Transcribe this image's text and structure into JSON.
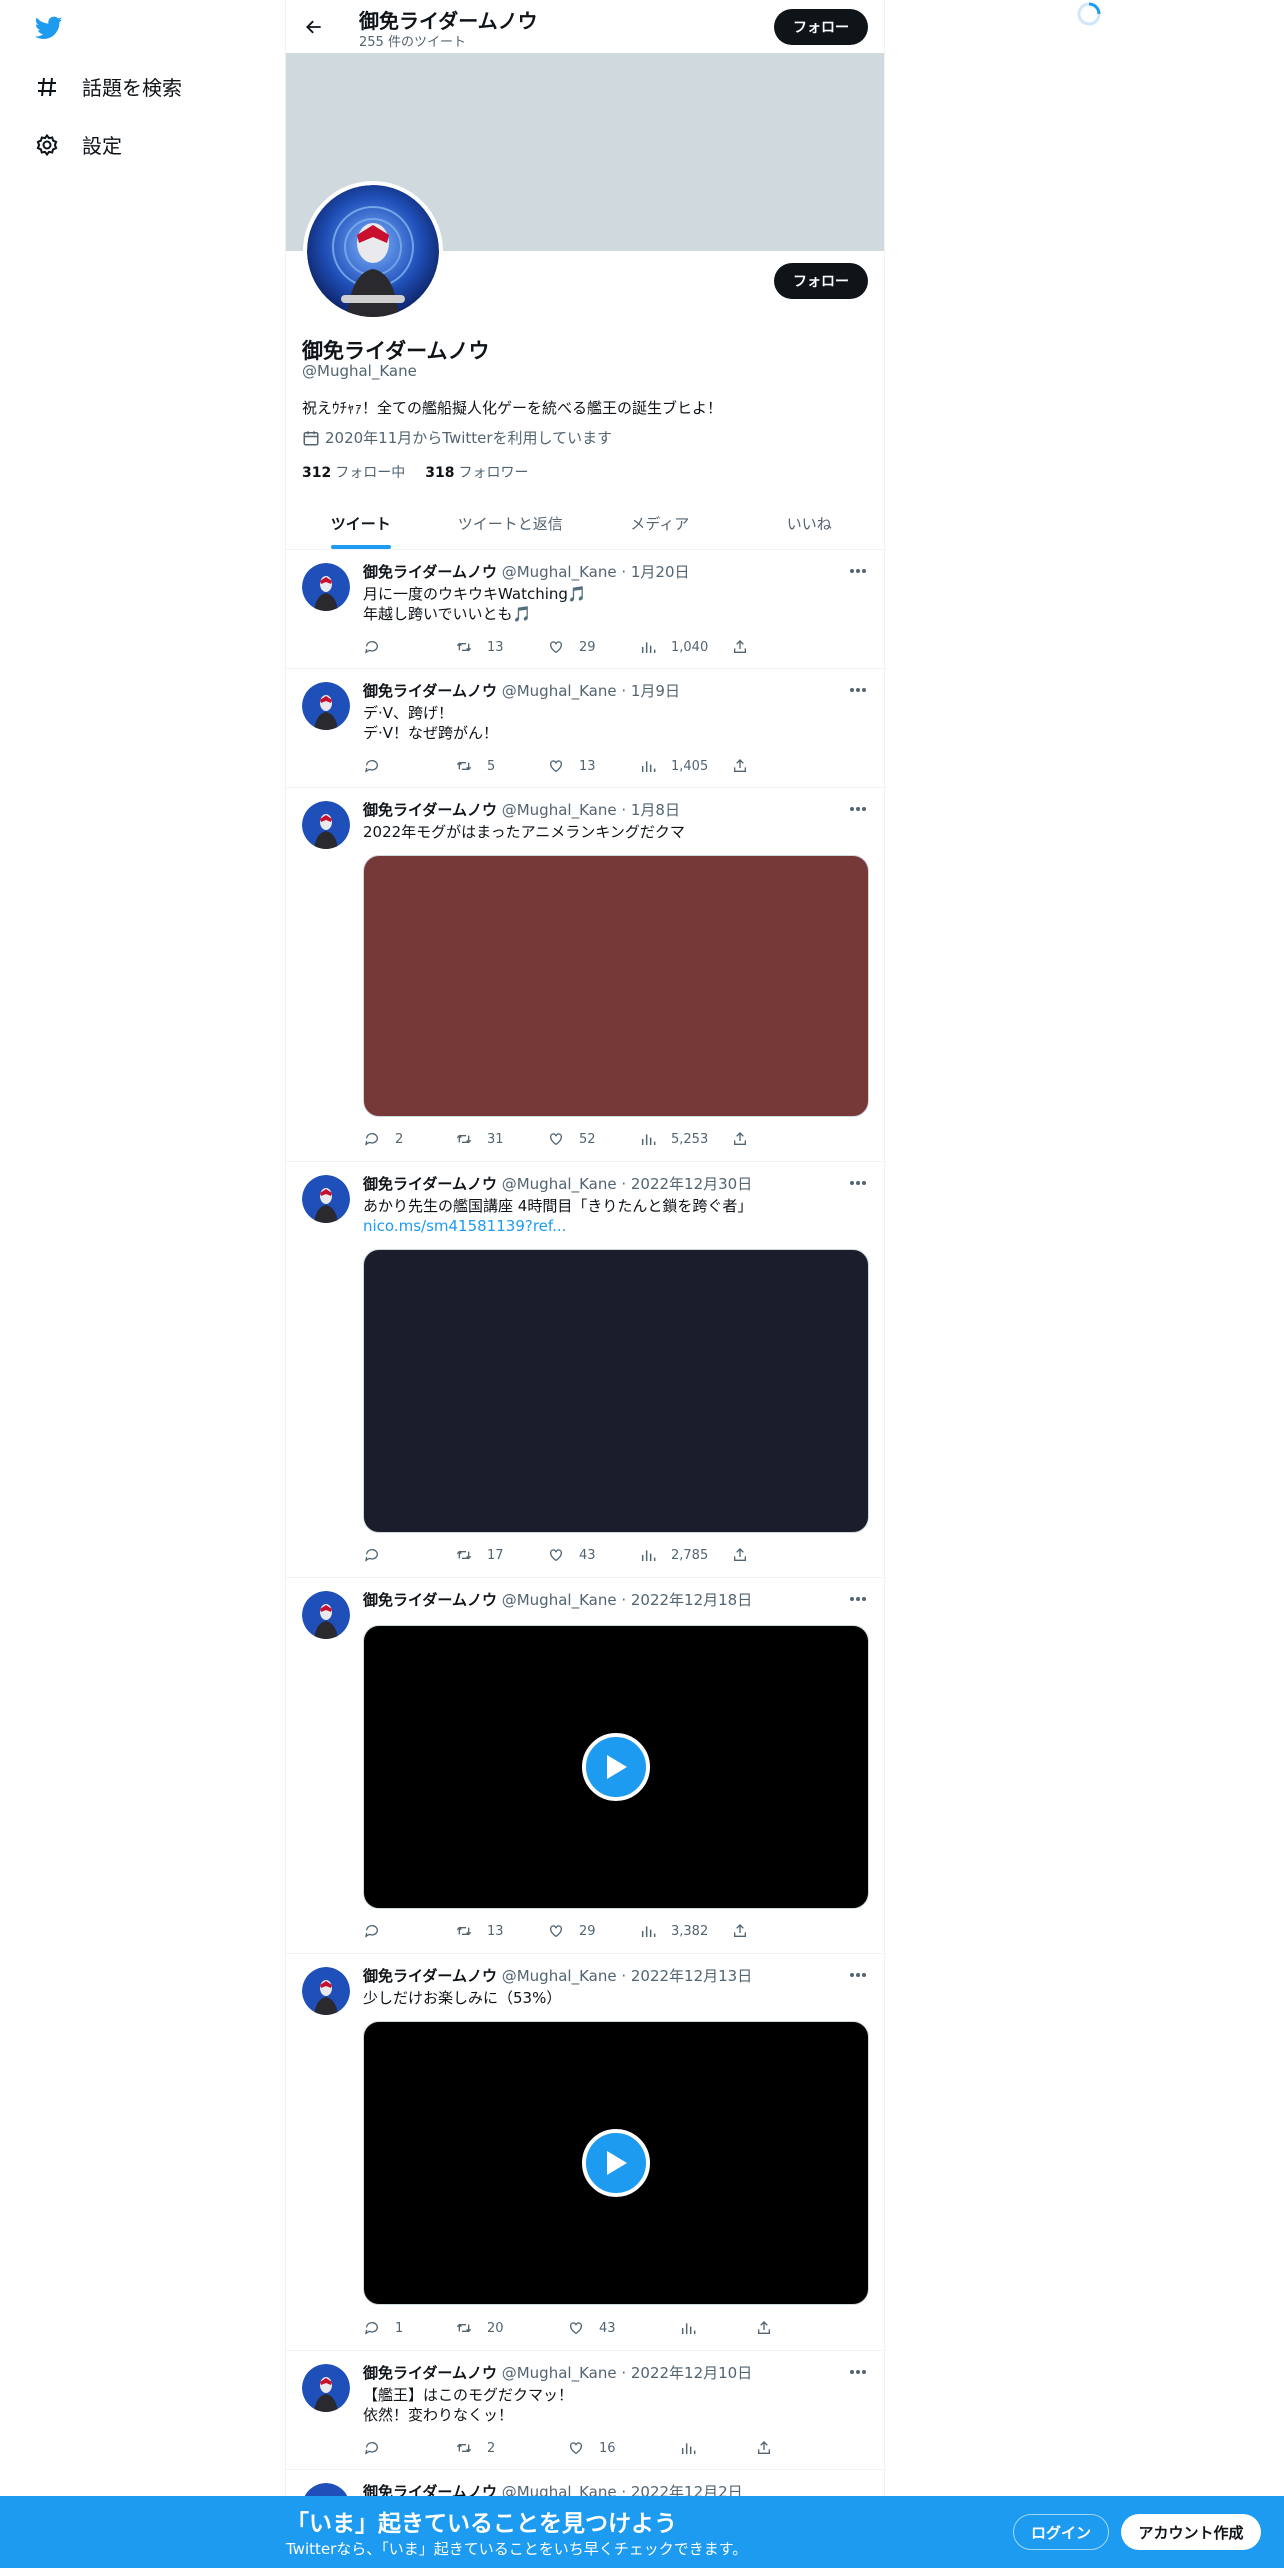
{
  "nav": {
    "items": [
      {
        "icon": "hashtag-icon",
        "label": "話題を検索"
      },
      {
        "icon": "gear-icon",
        "label": "設定"
      }
    ]
  },
  "header": {
    "name": "御免ライダームノウ",
    "tweet_count": "255 件のツイート",
    "follow_label": "フォロー"
  },
  "profile": {
    "name": "御免ライダームノウ",
    "handle": "@Mughal_Kane",
    "bio": "祝えｳﾁｬｧ！全ての艦船擬人化ゲーを統べる艦王の誕生ブヒよ！",
    "joined": "2020年11月からTwitterを利用しています",
    "following_count": "312",
    "following_label": "フォロー中",
    "followers_count": "318",
    "followers_label": "フォロワー",
    "follow_label": "フォロー"
  },
  "tabs": [
    "ツイート",
    "ツイートと返信",
    "メディア",
    "いいね"
  ],
  "tweets": [
    {
      "name": "御免ライダームノウ",
      "meta": "@Mughal_Kane · 1月20日",
      "line1": "月に一度のウキウキWatching🎵",
      "line2": "年越し跨いでいいとも🎵",
      "reply": "",
      "retweet": "13",
      "like": "29",
      "views": "1,040"
    },
    {
      "name": "御免ライダームノウ",
      "meta": "@Mughal_Kane · 1月9日",
      "line1": "デ·V、跨げ！",
      "line2": "デ·V！なぜ跨がん！",
      "reply": "",
      "retweet": "5",
      "like": "13",
      "views": "1,405"
    },
    {
      "name": "御免ライダームノウ",
      "meta": "@Mughal_Kane · 1月8日",
      "line1": "2022年モグがはまったアニメランキングだクマ",
      "reply": "2",
      "retweet": "31",
      "like": "52",
      "views": "5,253"
    },
    {
      "name": "御免ライダームノウ",
      "meta": "@Mughal_Kane · 2022年12月30日",
      "line1": "あかり先生の艦国講座 4時間目「きりたんと鎖を跨ぐ者」",
      "link": "nico.ms/sm41581139?ref...",
      "reply": "",
      "retweet": "17",
      "like": "43",
      "views": "2,785"
    },
    {
      "name": "御免ライダームノウ",
      "meta": "@Mughal_Kane · 2022年12月18日",
      "reply": "",
      "retweet": "13",
      "like": "29",
      "views": "3,382"
    },
    {
      "name": "御免ライダームノウ",
      "meta": "@Mughal_Kane · 2022年12月13日",
      "line1": "少しだけお楽しみに（53%）",
      "reply": "1",
      "retweet": "20",
      "like": "43",
      "views": ""
    },
    {
      "name": "御免ライダームノウ",
      "meta": "@Mughal_Kane · 2022年12月10日",
      "line1": "【艦王】はこのモグだクマッ！",
      "line2": "依然！変わりなくッ！",
      "reply": "",
      "retweet": "2",
      "like": "16",
      "views": ""
    },
    {
      "name": "御免ライダームノウ",
      "meta": "@Mughal_Kane · 2022年12月2日"
    }
  ],
  "bottom_bar": {
    "title": "「いま」起きていることを見つけよう",
    "subtitle": "Twitterなら、「いま」起きていることをいち早くチェックできます。",
    "login": "ログイン",
    "signup": "アカウント作成"
  },
  "colors": {
    "accent": "#1d9bf0",
    "media_maroon": "#773838",
    "media_navy": "#1b1c2c",
    "banner": "#cfd9de"
  }
}
